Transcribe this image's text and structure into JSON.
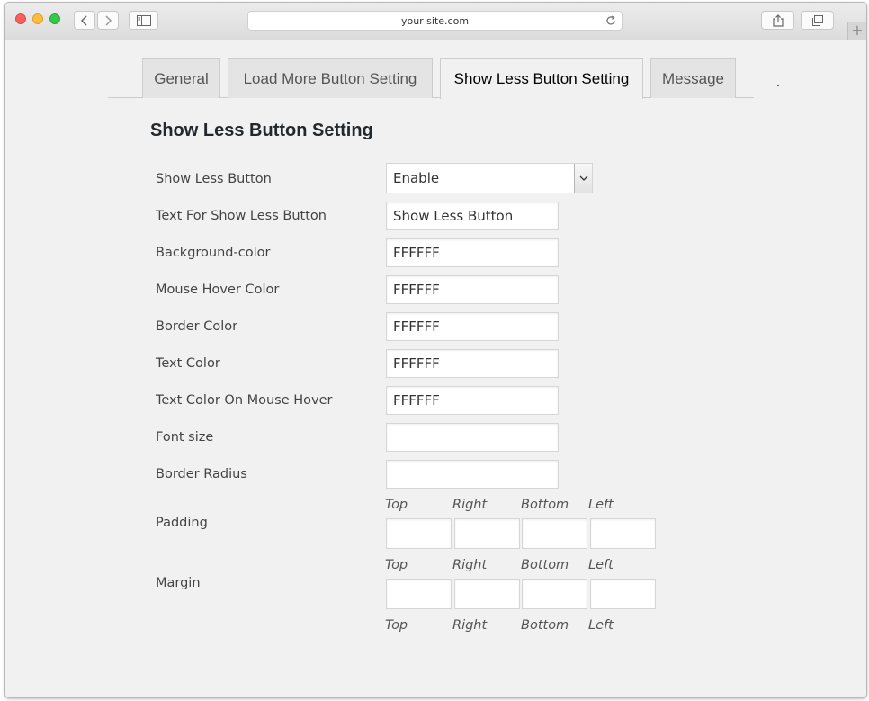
{
  "browser": {
    "url": "your site.com",
    "new_tab_symbol": "+"
  },
  "tabs": [
    {
      "label": "General"
    },
    {
      "label": "Load More Button Setting"
    },
    {
      "label": "Show Less Button Setting"
    },
    {
      "label": "Message"
    }
  ],
  "active_tab": "Show Less Button Setting",
  "section_title": "Show Less Button Setting",
  "fields": {
    "show_less_button": {
      "label": "Show Less Button",
      "value": "Enable"
    },
    "text_for_button": {
      "label": "Text For Show Less Button",
      "value": "Show Less Button"
    },
    "background_color": {
      "label": "Background-color",
      "value": "FFFFFF"
    },
    "mouse_hover_color": {
      "label": "Mouse Hover Color",
      "value": "FFFFFF"
    },
    "border_color": {
      "label": "Border Color",
      "value": "FFFFFF"
    },
    "text_color": {
      "label": "Text Color",
      "value": "FFFFFF"
    },
    "text_color_hover": {
      "label": "Text Color On Mouse Hover",
      "value": "FFFFFF"
    },
    "font_size": {
      "label": "Font size",
      "value": ""
    },
    "border_radius": {
      "label": "Border Radius",
      "value": ""
    },
    "padding": {
      "label": "Padding"
    },
    "margin": {
      "label": "Margin"
    }
  },
  "sides": {
    "top": "Top",
    "right": "Right",
    "bottom": "Bottom",
    "left": "Left"
  },
  "colors": {
    "page_bg": "#f1f1f1",
    "tab_inactive_bg": "#e4e4e4",
    "accent": "#1e73be"
  },
  "icons": [
    "back-icon",
    "forward-icon",
    "sidebar-icon",
    "reload-icon",
    "share-icon",
    "tabs-icon",
    "chevron-down-icon"
  ]
}
